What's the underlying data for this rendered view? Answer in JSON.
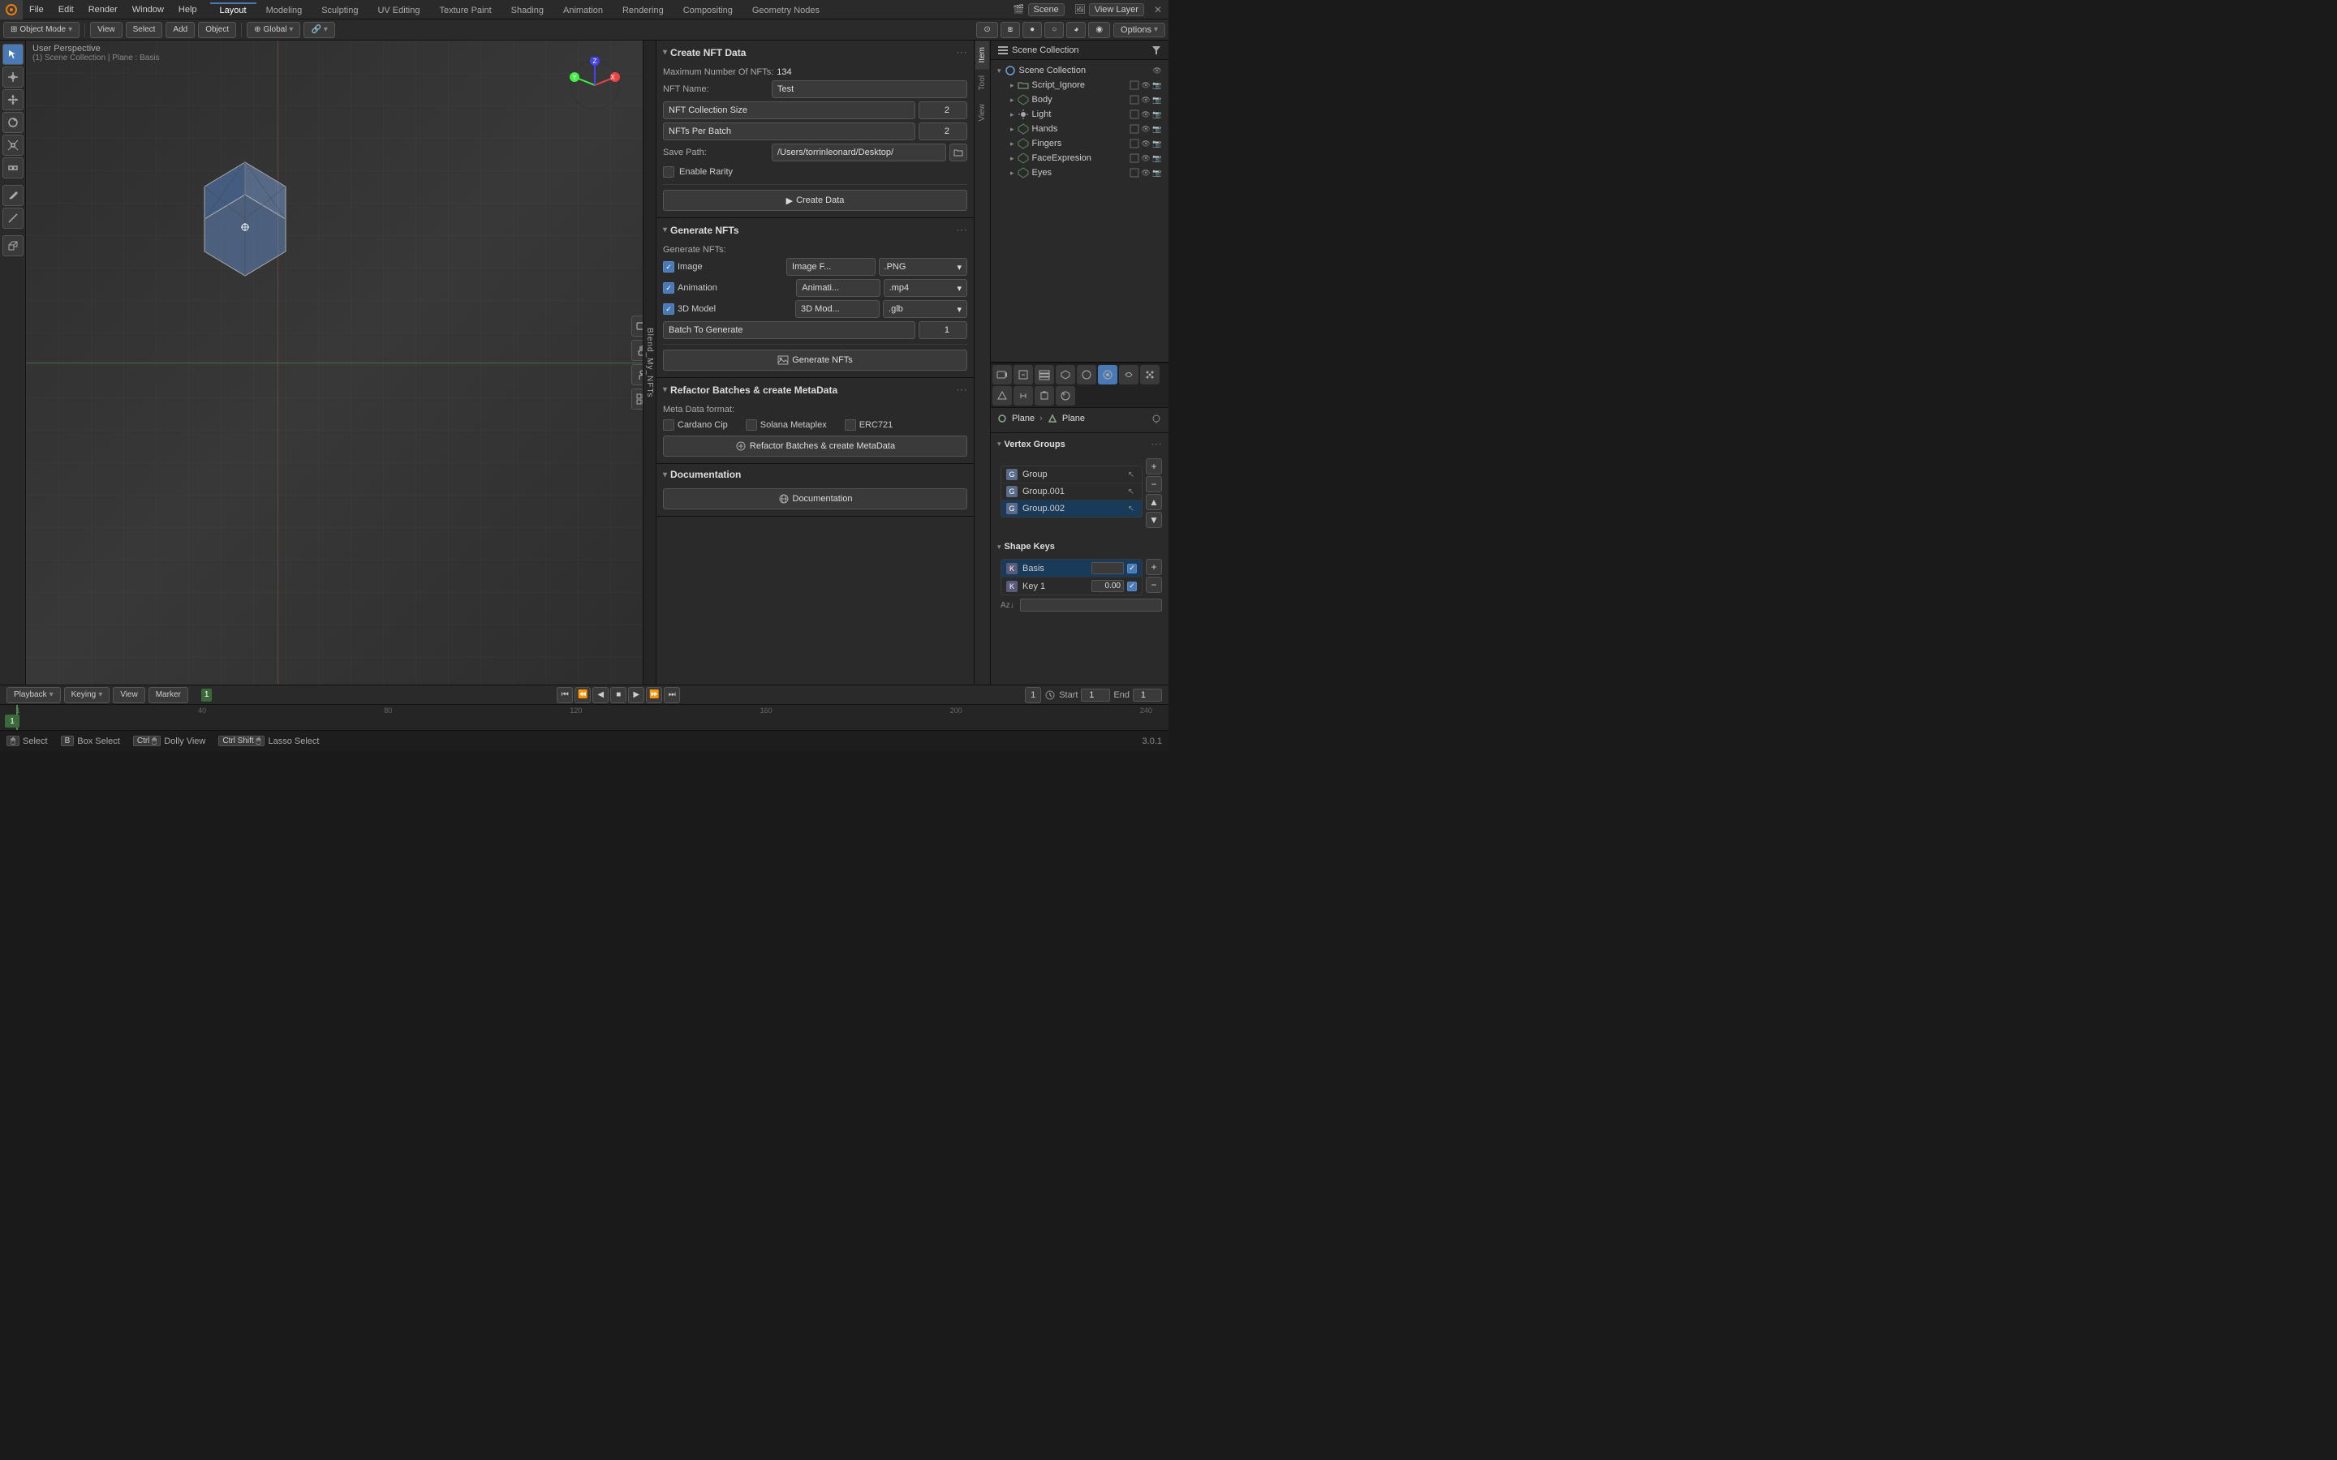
{
  "app": {
    "title": "Blender"
  },
  "top_menu": {
    "items": [
      "File",
      "Edit",
      "Render",
      "Window",
      "Help"
    ]
  },
  "workspace_tabs": {
    "tabs": [
      "Layout",
      "Modeling",
      "Sculpting",
      "UV Editing",
      "Texture Paint",
      "Shading",
      "Animation",
      "Rendering",
      "Compositing",
      "Geometry Nodes"
    ],
    "active": "Layout"
  },
  "top_right": {
    "engine": "Scene",
    "view_layer": "View Layer"
  },
  "second_toolbar": {
    "mode": "Object Mode",
    "view": "View",
    "select": "Select",
    "add": "Add",
    "object": "Object",
    "transform": "Global",
    "options_label": "Options"
  },
  "viewport": {
    "overlay_text": "User Perspective",
    "overlay_sub": "(1) Scene Collection | Plane : Basis"
  },
  "panel": {
    "create_nft": {
      "title": "Create NFT Data",
      "max_nfts_label": "Maximum Number Of NFTs:",
      "max_nfts_value": "134",
      "nft_name_label": "NFT Name:",
      "nft_name_value": "Test",
      "collection_size_label": "NFT Collection Size",
      "collection_size_value": "2",
      "per_batch_label": "NFTs Per Batch",
      "per_batch_value": "2",
      "save_path_label": "Save Path:",
      "save_path_value": "/Users/torrinleonard/Desktop/",
      "enable_rarity_label": "Enable Rarity",
      "create_data_btn": "Create Data"
    },
    "generate_nft": {
      "title": "Generate NFTs",
      "generate_nfts_label": "Generate NFTs:",
      "image_label": "Image",
      "image_format_label": "Image F...",
      "image_format_value": ".PNG",
      "animation_label": "Animation",
      "animation_format_label": "Animati...",
      "animation_format_value": ".mp4",
      "model_3d_label": "3D Model",
      "model_format_label": "3D Mod...",
      "model_format_value": ".glb",
      "batch_label": "Batch To Generate",
      "batch_value": "1",
      "generate_btn": "Generate NFTs"
    },
    "refactor": {
      "title": "Refactor Batches & create MetaData",
      "meta_format_label": "Meta Data format:",
      "cardano_label": "Cardano Cip",
      "solana_label": "Solana Metaplex",
      "erc721_label": "ERC721",
      "refactor_btn": "Refactor Batches & create MetaData"
    },
    "documentation": {
      "title": "Documentation",
      "doc_btn": "Documentation"
    }
  },
  "outliner": {
    "scene_collection_label": "Scene Collection",
    "items": [
      {
        "name": "Script_Ignore",
        "icon": "📁",
        "indent": 1
      },
      {
        "name": "Body",
        "icon": "▲",
        "indent": 1
      },
      {
        "name": "Light",
        "icon": "💡",
        "indent": 1
      },
      {
        "name": "Hands",
        "icon": "▲",
        "indent": 1
      },
      {
        "name": "Fingers",
        "icon": "▲",
        "indent": 1
      },
      {
        "name": "FaceExpresion",
        "icon": "▲",
        "indent": 1
      },
      {
        "name": "Eyes",
        "icon": "▲",
        "indent": 1
      }
    ]
  },
  "properties": {
    "object_name": "Plane",
    "mesh_name": "Plane",
    "vertex_groups": {
      "title": "Vertex Groups",
      "items": [
        {
          "name": "Group",
          "selected": false
        },
        {
          "name": "Group.001",
          "selected": false
        },
        {
          "name": "Group.002",
          "selected": true
        }
      ]
    },
    "shape_keys": {
      "title": "Shape Keys",
      "items": [
        {
          "name": "Basis",
          "value": "",
          "selected": true
        },
        {
          "name": "Key 1",
          "value": "0.00",
          "selected": false
        }
      ]
    }
  },
  "timeline": {
    "playback_label": "Playback",
    "keying_label": "Keying",
    "view_label": "View",
    "marker_label": "Marker",
    "frame_current": "1",
    "start_label": "Start",
    "start_value": "1",
    "end_label": "End",
    "end_value": "1",
    "frame_marks": [
      "1",
      "40",
      "80",
      "120",
      "160",
      "200",
      "240"
    ]
  },
  "status_bar": {
    "select_label": "Select",
    "box_select_label": "Box Select",
    "dolly_view_label": "Dolly View",
    "lasso_select_label": "Lasso Select",
    "version": "3.0.1"
  },
  "blend_my_nfts_label": "Blend_My_NFTs",
  "sidebar_tabs": {
    "tabs": [
      "Item",
      "Tool",
      "View"
    ]
  }
}
